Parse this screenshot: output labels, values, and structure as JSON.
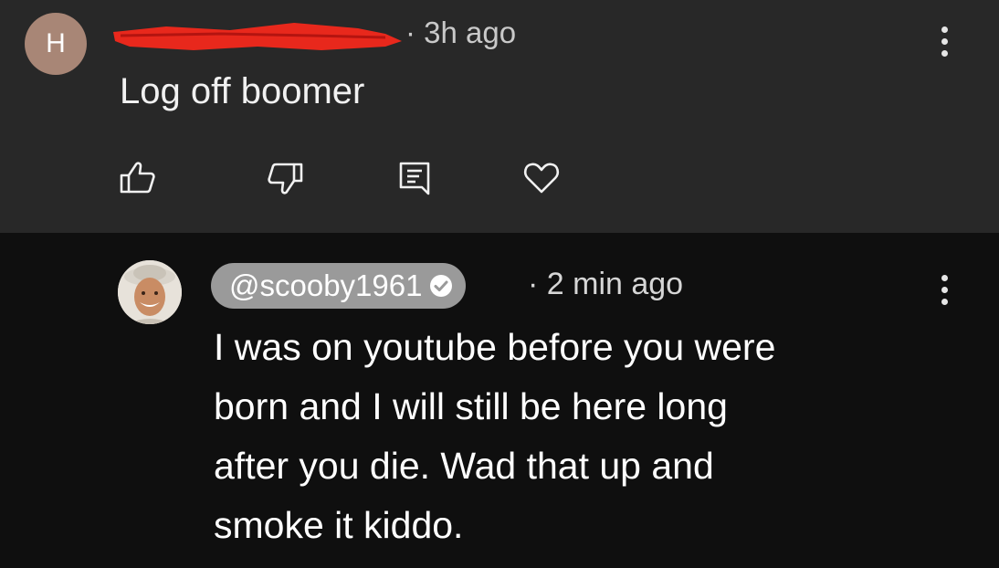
{
  "top_comment": {
    "avatar_letter": "H",
    "avatar_color": "#a88676",
    "author_redacted": true,
    "redaction_color": "#e8281c",
    "time": "· 3h ago",
    "text": "Log off boomer",
    "actions": {
      "like_icon": "thumb-up-icon",
      "dislike_icon": "thumb-down-icon",
      "reply_icon": "reply-comment-icon",
      "heart_icon": "heart-icon"
    },
    "background": "#282828"
  },
  "reply_comment": {
    "handle": "@scooby1961",
    "verified": true,
    "time": "· 2 min ago",
    "text": "I was on youtube before you were\nborn and I will still be here long\nafter you die.  Wad that up and\nsmoke it kiddo.",
    "pill_color": "#9a9a9a",
    "background": "#0f0f0f"
  }
}
